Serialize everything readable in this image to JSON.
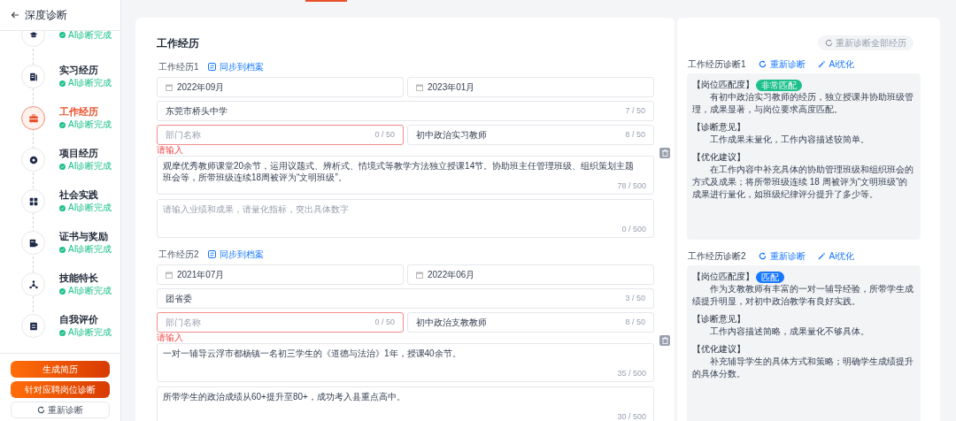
{
  "sidebar": {
    "title": "深度诊断",
    "steps": [
      {
        "status": "AI诊断完成",
        "selected": false
      },
      {
        "title": "实习经历",
        "status": "AI诊断完成",
        "selected": false
      },
      {
        "title": "工作经历",
        "status": "AI诊断完成",
        "selected": true
      },
      {
        "title": "项目经历",
        "status": "AI诊断完成",
        "selected": false
      },
      {
        "title": "社会实践",
        "status": "AI诊断完成",
        "selected": false
      },
      {
        "title": "证书与奖励",
        "status": "AI诊断完成",
        "selected": false
      },
      {
        "title": "技能特长",
        "status": "AI诊断完成",
        "selected": false
      },
      {
        "title": "自我评价",
        "status": "AI诊断完成",
        "selected": false
      }
    ],
    "buttons": [
      {
        "label": "生成简历",
        "kind": "primary"
      },
      {
        "label": "针对应聘岗位诊断",
        "kind": "primary"
      },
      {
        "label": "重新诊断",
        "kind": "outline"
      }
    ]
  },
  "main": {
    "title": "工作经历",
    "entries": [
      {
        "label": "工作经历1",
        "sync_link": "同步到档案",
        "start_date": "2022年09月",
        "end_date": "2023年01月",
        "company": {
          "value": "东莞市桥头中学",
          "count": "7 / 50"
        },
        "department": {
          "placeholder": "部门名称",
          "count": "0 / 50",
          "error": "请输入"
        },
        "position": {
          "value": "初中政治实习教师",
          "count": "8 / 50"
        },
        "description": {
          "value": "观摩优秀教师课堂20余节，运用议题式、辨析式、情境式等教学方法独立授课14节。协助班主任管理班级、组织策划主题班会等，所带班级连续18周被评为“文明班级”。",
          "count": "78 / 500"
        },
        "achievements": {
          "placeholder": "请输入业绩和成果，请量化指标，突出具体数字",
          "count": "0 / 500"
        }
      },
      {
        "label": "工作经历2",
        "sync_link": "同步到档案",
        "start_date": "2021年07月",
        "end_date": "2022年06月",
        "company": {
          "value": "团省委",
          "count": "3 / 50"
        },
        "department": {
          "placeholder": "部门名称",
          "count": "0 / 50",
          "error": "请输入"
        },
        "position": {
          "value": "初中政治支教教师",
          "count": "8 / 50"
        },
        "description": {
          "value": "一对一辅导云浮市都杨镇一名初三学生的《道德与法治》1年，授课40余节。",
          "count": "35 / 500"
        },
        "achievements": {
          "value": "所带学生的政治成绩从60+提升至80+，成功考入县重点高中。",
          "count": "30 / 500"
        }
      }
    ]
  },
  "diagnosis": {
    "reset_all_button": "重新诊断全部经历",
    "items": [
      {
        "title": "工作经历诊断1",
        "rediagnose_link": "重新诊断",
        "optimize_link": "Ai优化",
        "sections": [
          {
            "heading": "【岗位匹配度】",
            "badge": {
              "label": "非常匹配",
              "color": "#1cc08a"
            },
            "text": "有初中政治实习教师的经历，独立授课并协助班级管理，成果显著，与岗位要求高度匹配。"
          },
          {
            "heading": "【诊断意见】",
            "text": "工作成果未量化，工作内容描述较简单。"
          },
          {
            "heading": "【优化建议】",
            "text": "在工作内容中补充具体的协助管理班级和组织班会的方式及成果；将所带班级连续 18 周被评为“文明班级”的成果进行量化，如班级纪律评分提升了多少等。"
          }
        ]
      },
      {
        "title": "工作经历诊断2",
        "rediagnose_link": "重新诊断",
        "optimize_link": "Ai优化",
        "sections": [
          {
            "heading": "【岗位匹配度】",
            "badge": {
              "label": "匹配",
              "color": "#1677ff"
            },
            "text": "作为支教教师有丰富的一对一辅导经验，所带学生成绩提升明显，对初中政治教学有良好实践。"
          },
          {
            "heading": "【诊断意见】",
            "text": "工作内容描述简略，成果量化不够具体。"
          },
          {
            "heading": "【优化建议】",
            "text": "补充辅导学生的具体方式和策略；明确学生成绩提升的具体分数。"
          }
        ]
      }
    ]
  }
}
